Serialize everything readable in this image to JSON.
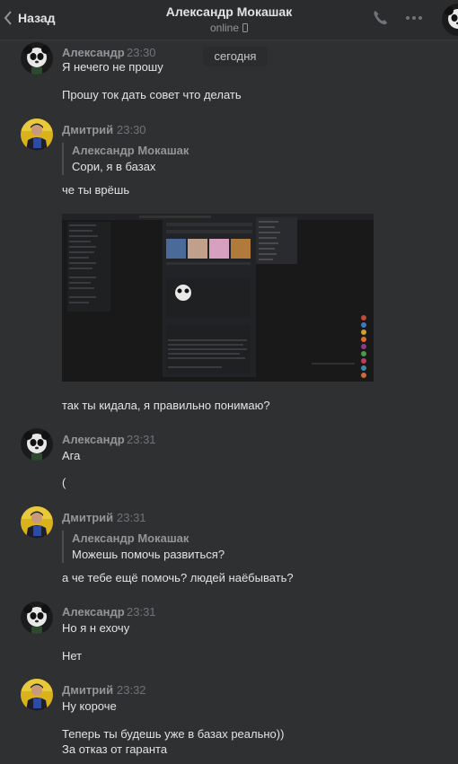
{
  "header": {
    "back_label": "Назад",
    "title": "Александр Мокашак",
    "status": "online"
  },
  "date_divider": "сегодня",
  "messages": [
    {
      "author": "Александр",
      "time": "23:30",
      "lines": [
        "Я нечего не прошу",
        "Прошу ток дать совет что делать"
      ]
    },
    {
      "author": "Дмитрий",
      "time": "23:30",
      "quote": {
        "author": "Александр Мокашак",
        "text": "Сори, я в базах"
      },
      "lines": [
        "че ты врёшь",
        "так ты кидала, я правильно понимаю?"
      ]
    },
    {
      "author": "Александр",
      "time": "23:31",
      "lines": [
        "Ага",
        "("
      ]
    },
    {
      "author": "Дмитрий",
      "time": "23:31",
      "quote": {
        "author": "Александр Мокашак",
        "text": "Можешь помочь развиться?"
      },
      "lines": [
        "а че тебе ещё помочь? людей наёбывать?"
      ]
    },
    {
      "author": "Александр",
      "time": "23:31",
      "lines": [
        "Но я н ехочу",
        "Нет"
      ]
    },
    {
      "author": "Дмитрий",
      "time": "23:32",
      "lines": [
        "Ну короче",
        "Теперь ты будешь уже в базах реально))",
        "За отказ от гаранта"
      ]
    }
  ],
  "colors": {
    "background": "#2f3032",
    "header": "#2b2c2e",
    "text": "#e1e3e6",
    "muted": "#939699",
    "time": "#6f7378"
  }
}
